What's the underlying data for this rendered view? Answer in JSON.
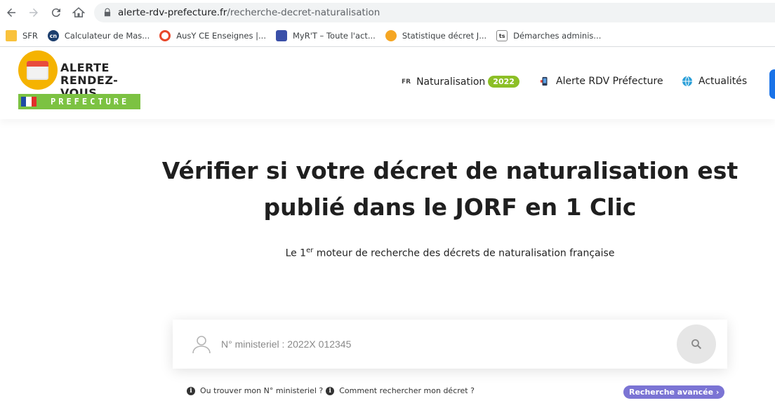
{
  "browser": {
    "url_host": "alerte-rdv-prefecture.fr",
    "url_path": "/recherche-decret-naturalisation",
    "bookmarks": [
      {
        "label": "SFR",
        "icon": "folder-icon"
      },
      {
        "label": "Calculateur de Mas...",
        "icon": "cnrs-icon"
      },
      {
        "label": "AusY CE Enseignes |...",
        "icon": "ausy-icon"
      },
      {
        "label": "MyR'T – Toute l'act...",
        "icon": "myrt-icon"
      },
      {
        "label": "Statistique décret J...",
        "icon": "stat-icon"
      },
      {
        "label": "Démarches adminis...",
        "icon": "document-icon"
      }
    ]
  },
  "header": {
    "logo": {
      "line1": "ALERTE",
      "line2": "RENDEZ-VOUS",
      "band": "PREFECTURE"
    },
    "menu": {
      "naturalisation": {
        "prefix": "FR",
        "label": "Naturalisation",
        "badge": "2022"
      },
      "alerte": {
        "label": "Alerte RDV Préfecture"
      },
      "actualites": {
        "label": "Actualités"
      }
    },
    "colors": {
      "accent_green": "#8cbf26",
      "logo_yellow": "#f5b301",
      "cta_blue": "#1a73e8"
    }
  },
  "hero": {
    "title_line1": "Vérifier si votre décret de naturalisation est",
    "title_line2": "publié dans le JORF en 1 Clic",
    "subtitle_pre": "Le 1",
    "subtitle_sup": "er",
    "subtitle_post": " moteur de recherche des décrets de naturalisation française"
  },
  "search": {
    "placeholder": "N° ministeriel : 2022X 012345",
    "value": ""
  },
  "help": {
    "link1": "Ou trouver mon N° ministeriel ?",
    "link2": "Comment rechercher mon décret ?",
    "advanced": "Recherche avancée ›",
    "advanced_color": "#7b74d4"
  }
}
